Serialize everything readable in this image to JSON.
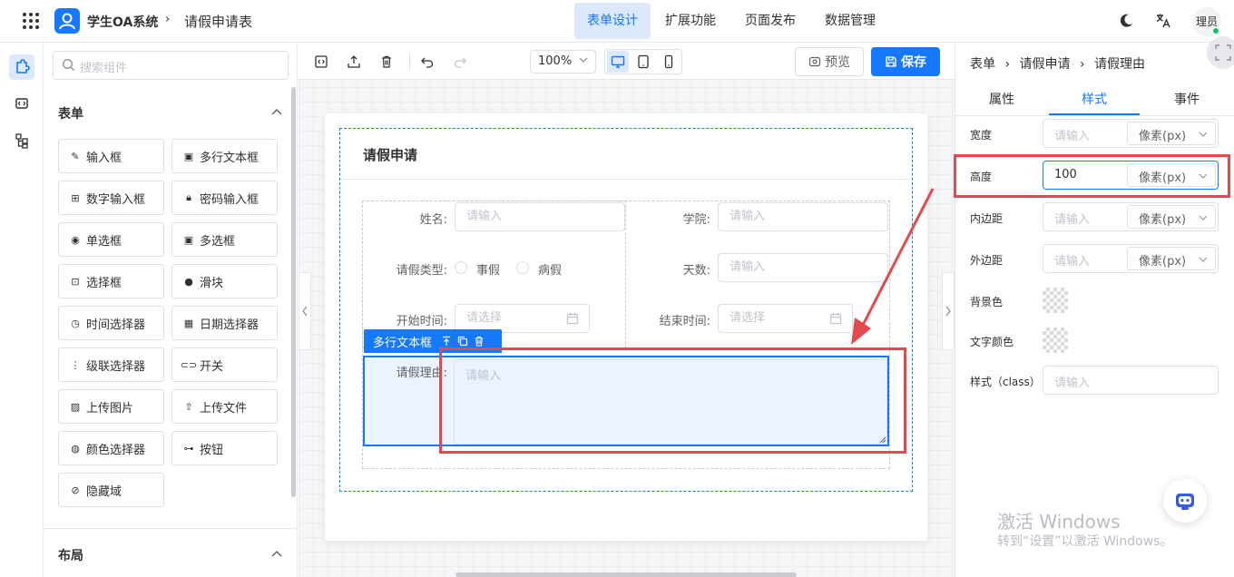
{
  "header": {
    "app_title": "学生OA系统",
    "separator": "›",
    "page_title": "请假申请表",
    "nav_tabs": [
      {
        "label": "表单设计"
      },
      {
        "label": "扩展功能"
      },
      {
        "label": "页面发布"
      },
      {
        "label": "数据管理"
      }
    ],
    "user_label": "理员"
  },
  "components_panel": {
    "search_placeholder": "搜索组件",
    "form_section": "表单",
    "layout_section": "布局",
    "items": [
      {
        "label": "输入框",
        "icon": "edit-icon"
      },
      {
        "label": "多行文本框",
        "icon": "textarea-icon"
      },
      {
        "label": "数字输入框",
        "icon": "number-icon"
      },
      {
        "label": "密码输入框",
        "icon": "lock-icon"
      },
      {
        "label": "单选框",
        "icon": "radio-icon"
      },
      {
        "label": "多选框",
        "icon": "checkbox-icon"
      },
      {
        "label": "选择框",
        "icon": "select-icon"
      },
      {
        "label": "滑块",
        "icon": "slider-icon"
      },
      {
        "label": "时间选择器",
        "icon": "clock-icon"
      },
      {
        "label": "日期选择器",
        "icon": "calendar-icon"
      },
      {
        "label": "级联选择器",
        "icon": "cascader-icon"
      },
      {
        "label": "开关",
        "icon": "switch-icon"
      },
      {
        "label": "上传图片",
        "icon": "image-icon"
      },
      {
        "label": "上传文件",
        "icon": "upload-icon"
      },
      {
        "label": "颜色选择器",
        "icon": "palette-icon"
      },
      {
        "label": "按钮",
        "icon": "button-icon"
      },
      {
        "label": "隐藏域",
        "icon": "eye-off-icon"
      }
    ]
  },
  "toolbar": {
    "zoom": "100%",
    "preview_label": "预览",
    "save_label": "保存"
  },
  "form": {
    "title": "请假申请",
    "fields": {
      "name_label": "姓名:",
      "name_placeholder": "请输入",
      "college_label": "学院:",
      "college_placeholder": "请输入",
      "leave_type_label": "请假类型:",
      "leave_type_options": [
        "事假",
        "病假"
      ],
      "days_label": "天数:",
      "days_placeholder": "请输入",
      "start_label": "开始时间:",
      "start_placeholder": "请选择",
      "end_label": "结束时间:",
      "end_placeholder": "请选择",
      "reason_label": "请假理由:",
      "reason_placeholder": "请输入"
    },
    "selected_tag": "多行文本框"
  },
  "props_panel": {
    "breadcrumb": [
      "表单",
      "请假申请",
      "请假理由"
    ],
    "crumb_sep": "›",
    "tabs": [
      "属性",
      "样式",
      "事件"
    ],
    "active_tab": "样式",
    "rows": {
      "width_label": "宽度",
      "height_label": "高度",
      "padding_label": "内边距",
      "margin_label": "外边距",
      "bg_label": "背景色",
      "text_color_label": "文字颜色",
      "class_label": "样式（class）"
    },
    "placeholder": "请输入",
    "height_value": "100",
    "unit": "像素(px)"
  },
  "watermark": {
    "line1": "激活 Windows",
    "line2": "转到“设置”以激活 Windows。"
  },
  "colors": {
    "primary": "#1677ff",
    "highlight_red": "#e5484d",
    "active_bg": "#dbe9fb"
  }
}
